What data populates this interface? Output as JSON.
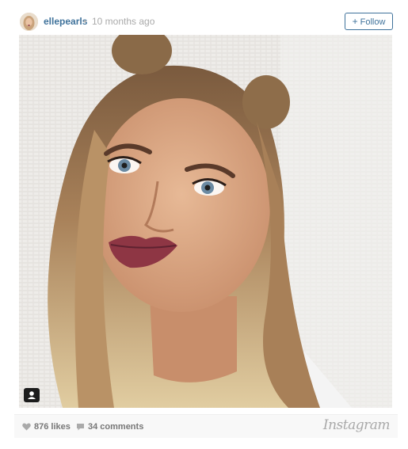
{
  "post": {
    "username": "ellepearls",
    "separator": "•",
    "timestamp": "10 months ago",
    "follow_label": "Follow",
    "follow_icon": "plus-icon"
  },
  "photo": {
    "alt": "Selfie of a woman with blonde ombre hair in two top buns, dark berry lipstick",
    "user_tag_icon": "person-tag-icon"
  },
  "footer": {
    "likes": "876 likes",
    "comments": "34 comments",
    "brand": "Instagram",
    "like_icon": "heart-icon",
    "comment_icon": "speech-bubble-icon"
  },
  "colors": {
    "link_blue": "#3f729b",
    "muted_text": "#777777",
    "footer_bg": "#f8f8f8"
  }
}
